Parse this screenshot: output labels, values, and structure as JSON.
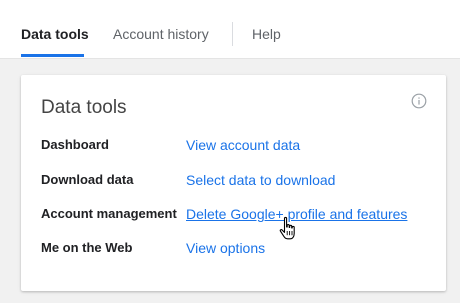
{
  "tabs": [
    {
      "label": "Data tools",
      "active": true
    },
    {
      "label": "Account history",
      "active": false
    },
    {
      "label": "Help",
      "active": false
    }
  ],
  "card": {
    "title": "Data tools",
    "info_icon": "info-icon",
    "rows": [
      {
        "label": "Dashboard",
        "link": "View account data"
      },
      {
        "label": "Download data",
        "link": "Select data to download"
      },
      {
        "label": "Account management",
        "link": "Delete Google+ profile and features"
      },
      {
        "label": "Me on the Web",
        "link": "View options"
      }
    ]
  },
  "colors": {
    "accent": "#1a73e8",
    "background": "#f1f1f1"
  },
  "cursor_icon": "hand-pointer-icon"
}
